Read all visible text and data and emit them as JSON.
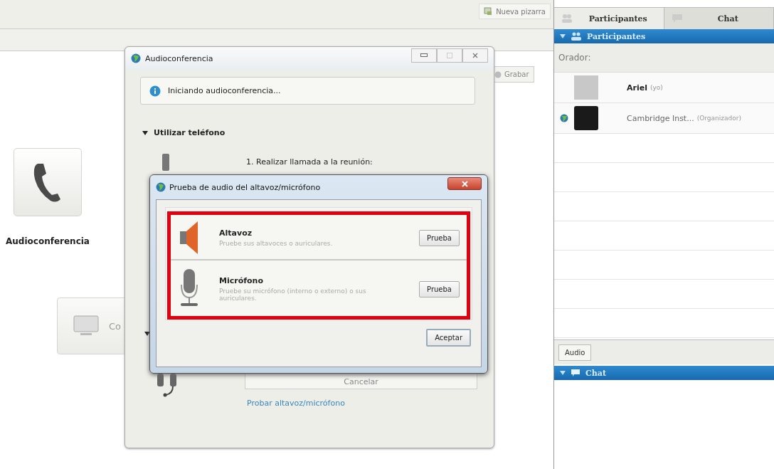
{
  "toolbar": {
    "new_whiteboard": "Nueva pizarra",
    "record": "Grabar"
  },
  "tiles": [
    {
      "kind": "phone",
      "label": "Audioconferencia"
    },
    {
      "kind": "computer",
      "label": "Co"
    }
  ],
  "audio_window": {
    "title": "Audioconferencia",
    "info": "Iniciando audioconferencia...",
    "section_1": "Utilizar teléfono",
    "step": "1. Realizar llamada a la reunión:",
    "cancel": "Cancelar",
    "test_link": "Probar altavoz/micrófono"
  },
  "test_dialog": {
    "title": "Prueba de audio del altavoz/micrófono",
    "devices": [
      {
        "kind": "speaker",
        "name": "Altavoz",
        "hint": "Pruebe sus altavoces o auriculares.",
        "button": "Prueba"
      },
      {
        "kind": "microphone",
        "name": "Micrófono",
        "hint": "Pruebe su micrófono (interno o externo) o sus auriculares.",
        "button": "Prueba"
      }
    ],
    "ok": "Aceptar"
  },
  "panel": {
    "tabs": [
      {
        "label": "Participantes",
        "selected": true
      },
      {
        "label": "Chat",
        "selected": false
      }
    ],
    "participants_header": "Participantes",
    "speaker_label": "Orador:",
    "participants": [
      {
        "name": "Ariel",
        "note": "(yo)",
        "online": false
      },
      {
        "name": "Cambridge Inst...",
        "note": "(Organizador)",
        "online": true
      }
    ],
    "audio_button": "Audio",
    "chat_header": "Chat"
  }
}
